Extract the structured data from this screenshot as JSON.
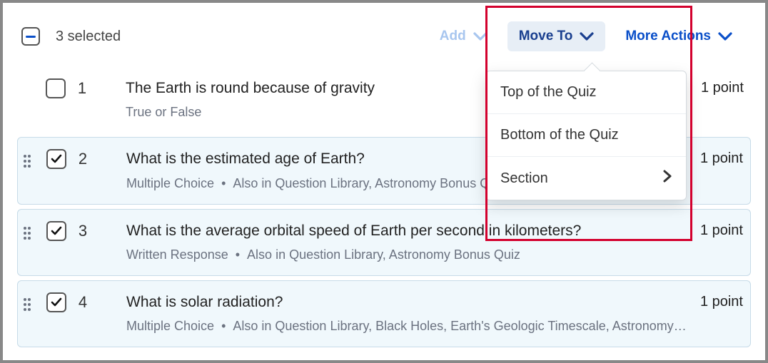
{
  "toolbar": {
    "selected_text": "3 selected",
    "add_label": "Add",
    "moveto_label": "Move To",
    "more_label": "More Actions"
  },
  "popover": {
    "top_label": "Top of the Quiz",
    "bottom_label": "Bottom of the Quiz",
    "section_label": "Section"
  },
  "rows": [
    {
      "num": "1",
      "selected": false,
      "title": "The Earth is round because of gravity",
      "type": "True or False",
      "extra": "",
      "points": "1 point"
    },
    {
      "num": "2",
      "selected": true,
      "title": "What is the estimated age of Earth?",
      "type": "Multiple Choice",
      "extra": "Also in Question Library, Astronomy Bonus Quiz",
      "points": "1 point"
    },
    {
      "num": "3",
      "selected": true,
      "title": "What is the average orbital speed of Earth per second in kilometers?",
      "type": "Written Response",
      "extra": "Also in Question Library, Astronomy Bonus Quiz",
      "points": "1 point"
    },
    {
      "num": "4",
      "selected": true,
      "title": "What is solar radiation?",
      "type": "Multiple Choice",
      "extra": "Also in Question Library, Black Holes, Earth's Geologic Timescale, Astronomy Bonus Quiz",
      "points": "1 point"
    }
  ]
}
